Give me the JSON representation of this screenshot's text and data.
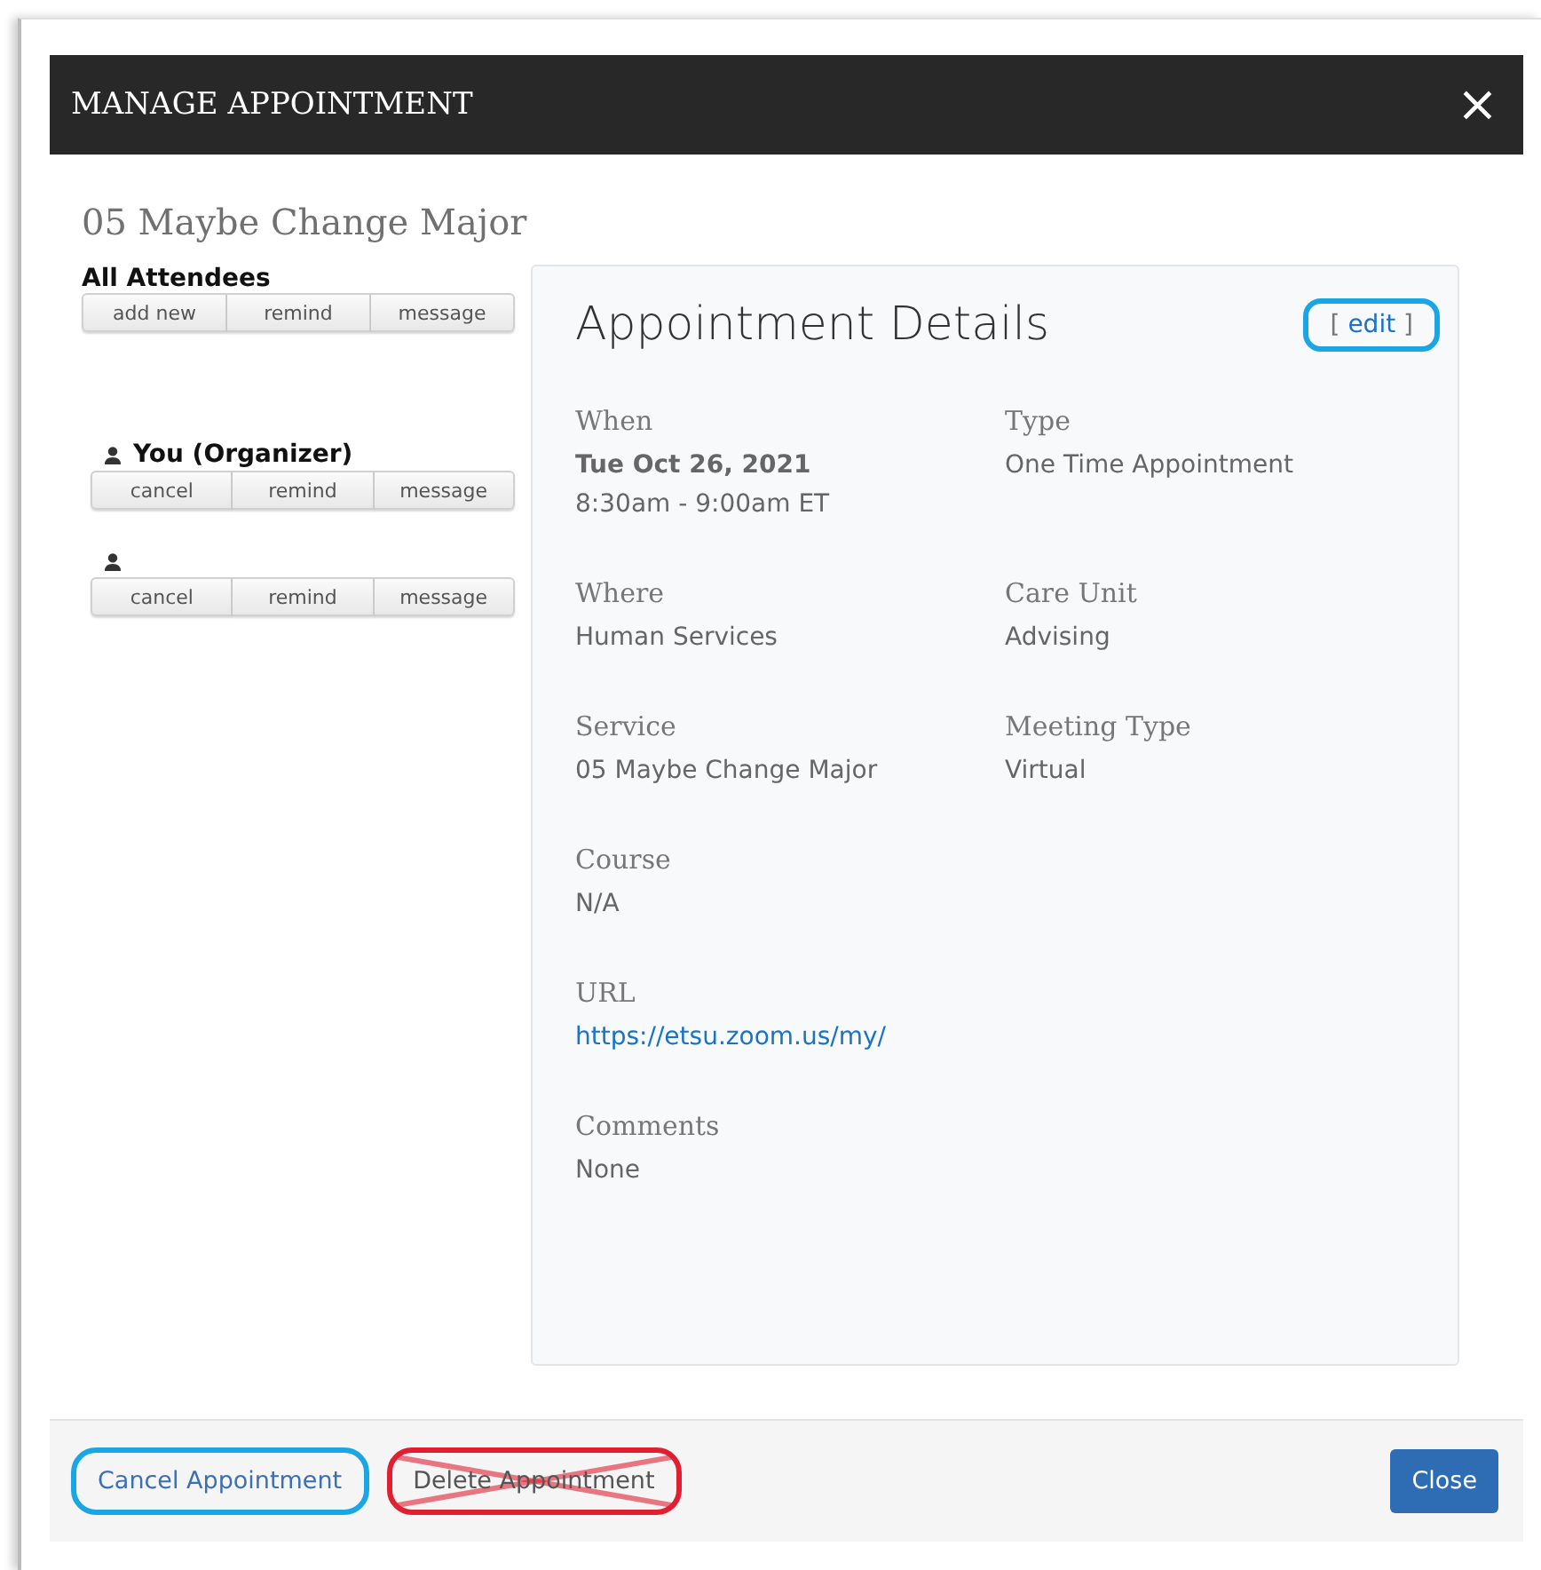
{
  "dialog": {
    "title": "MANAGE APPOINTMENT",
    "close": "×"
  },
  "appointment_title": "05 Maybe Change Major",
  "all_attendees": {
    "heading": "All Attendees",
    "actions": [
      "add new",
      "remind",
      "message"
    ]
  },
  "attendees": [
    {
      "name": "You (Organizer)",
      "actions": [
        "cancel",
        "remind",
        "message"
      ]
    },
    {
      "actions": [
        "cancel",
        "remind",
        "message"
      ]
    }
  ],
  "details": {
    "title": "Appointment Details",
    "edit": {
      "open": "[",
      "label": "edit",
      "close": "]",
      "circled": true
    },
    "rows": [
      [
        {
          "label": "When",
          "lines": [
            {
              "text": "Tue Oct 26, 2021",
              "bold": true
            },
            {
              "text": "8:30am - 9:00am ET",
              "bold": false
            }
          ]
        },
        {
          "label": "Type",
          "lines": [
            {
              "text": "One Time Appointment",
              "bold": false
            }
          ]
        }
      ],
      [
        {
          "label": "Where",
          "lines": [
            {
              "text": "Human Services",
              "bold": false
            }
          ]
        },
        {
          "label": "Care Unit",
          "lines": [
            {
              "text": "Advising",
              "bold": false
            }
          ]
        }
      ],
      [
        {
          "label": "Service",
          "lines": [
            {
              "text": "05 Maybe Change Major",
              "bold": false
            }
          ]
        },
        {
          "label": "Meeting Type",
          "lines": [
            {
              "text": "Virtual",
              "bold": false
            }
          ]
        }
      ],
      [
        {
          "label": "Course",
          "lines": [
            {
              "text": "N/A",
              "bold": false
            }
          ]
        }
      ],
      [
        {
          "label": "URL",
          "lines": [
            {
              "text": "https://etsu.zoom.us/my/",
              "bold": false,
              "kind": "link"
            }
          ]
        }
      ],
      [
        {
          "label": "Comments",
          "lines": [
            {
              "text": "None",
              "bold": false
            }
          ]
        }
      ]
    ]
  },
  "footer": [
    {
      "label": "Cancel Appointment",
      "kind": "link",
      "circled": true,
      "crossed": false
    },
    {
      "label": "Delete Appointment",
      "kind": "plain",
      "circled": true,
      "crossed": true
    },
    {
      "label": "Close",
      "kind": "primary",
      "circled": false,
      "crossed": false
    }
  ]
}
